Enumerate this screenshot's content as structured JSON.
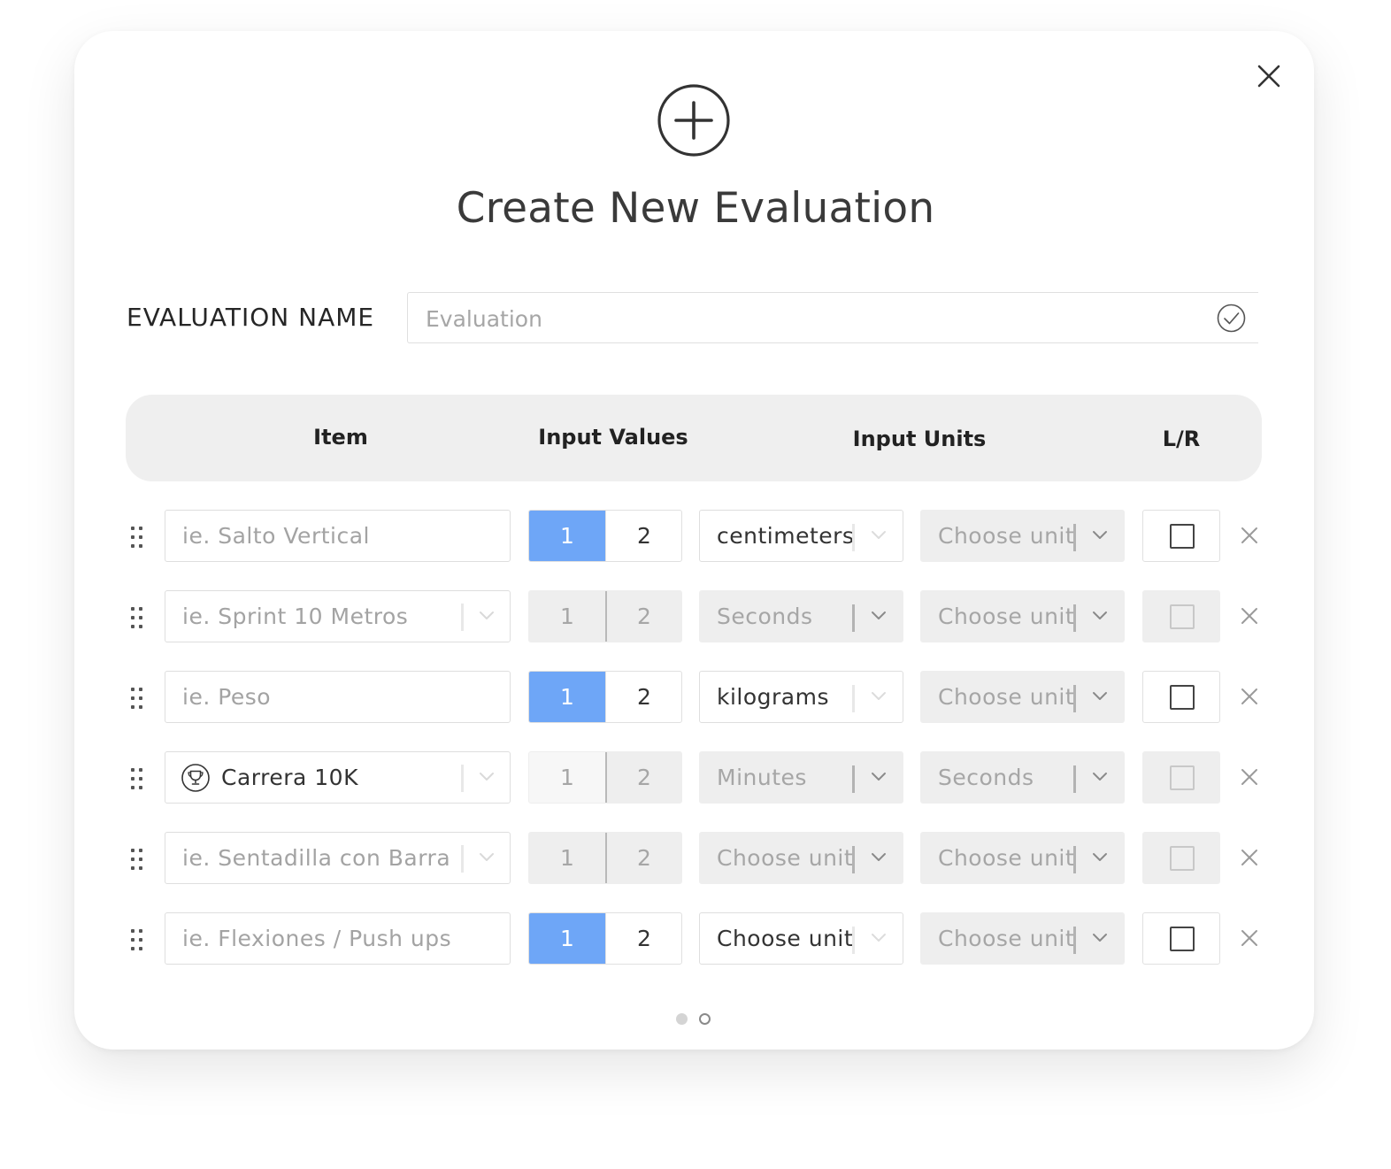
{
  "modal": {
    "title": "Create New Evaluation",
    "hero_icon": "plus-circle-icon",
    "close_icon": "close-icon"
  },
  "evaluation_name": {
    "label": "EVALUATION NAME",
    "placeholder": "Evaluation",
    "value": "",
    "check_icon": "check-circle-icon"
  },
  "table": {
    "headers": {
      "item": "Item",
      "input_values": "Input Values",
      "input_units": "Input Units",
      "lr": "L/R"
    },
    "rows": [
      {
        "item": "ie. Salto Vertical",
        "item_filled": false,
        "item_dropdown": false,
        "value_selected": "1",
        "values": [
          "1",
          "2"
        ],
        "values_disabled": false,
        "unit1": "centimeters",
        "unit1_disabled": false,
        "unit2": "Choose unit",
        "unit2_disabled": true,
        "lr_disabled": false,
        "lr_checked": false
      },
      {
        "item": "ie. Sprint 10 Metros",
        "item_filled": false,
        "item_dropdown": true,
        "value_selected": "",
        "values": [
          "1",
          "2"
        ],
        "values_disabled": true,
        "unit1": "Seconds",
        "unit1_disabled": true,
        "unit2": "Choose unit",
        "unit2_disabled": true,
        "lr_disabled": true,
        "lr_checked": false
      },
      {
        "item": "ie. Peso",
        "item_filled": false,
        "item_dropdown": false,
        "value_selected": "1",
        "values": [
          "1",
          "2"
        ],
        "values_disabled": false,
        "unit1": "kilograms",
        "unit1_disabled": false,
        "unit2": "Choose unit",
        "unit2_disabled": true,
        "lr_disabled": false,
        "lr_checked": false
      },
      {
        "item": "Carrera 10K",
        "item_filled": true,
        "item_icon": "trophy-icon",
        "item_dropdown": true,
        "value_selected": "",
        "values": [
          "1",
          "2"
        ],
        "values_disabled": true,
        "unit1": "Minutes",
        "unit1_disabled": true,
        "unit2": "Seconds",
        "unit2_disabled": true,
        "lr_disabled": true,
        "lr_checked": false
      },
      {
        "item": "ie. Sentadilla con Barra",
        "item_filled": false,
        "item_dropdown": true,
        "value_selected": "",
        "values": [
          "1",
          "2"
        ],
        "values_disabled": true,
        "unit1": "Choose unit",
        "unit1_disabled": true,
        "unit2": "Choose unit",
        "unit2_disabled": true,
        "lr_disabled": true,
        "lr_checked": false
      },
      {
        "item": "ie. Flexiones / Push ups",
        "item_filled": false,
        "item_dropdown": false,
        "value_selected": "1",
        "values": [
          "1",
          "2"
        ],
        "values_disabled": false,
        "unit1": "Choose unit",
        "unit1_disabled": false,
        "unit2": "Choose unit",
        "unit2_disabled": true,
        "lr_disabled": false,
        "lr_checked": false
      }
    ],
    "drag_icon": "drag-handle-icon",
    "remove_icon": "remove-row-icon",
    "chevron_icon": "chevron-down-icon"
  },
  "pagination": {
    "pages": 2,
    "current": 1
  },
  "colors": {
    "accent": "#6ea6f7",
    "disabled_bg": "#eeeeee",
    "header_bg": "#efefef",
    "text": "#333333",
    "placeholder": "#a3a3a3"
  }
}
